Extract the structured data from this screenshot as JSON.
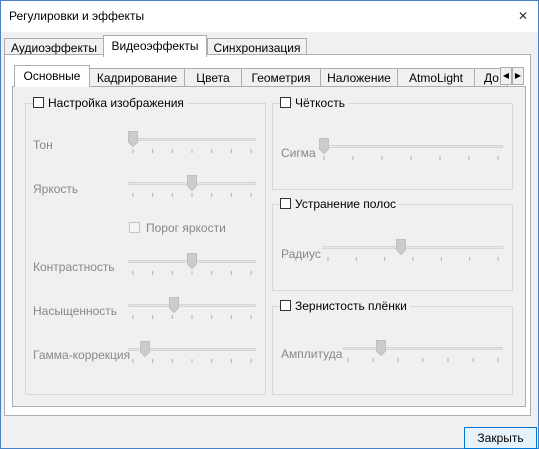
{
  "window": {
    "title": "Регулировки и эффекты"
  },
  "tabs": [
    "Аудиоэффекты",
    "Видеоэффекты",
    "Синхронизация"
  ],
  "subtabs": [
    "Основные",
    "Кадрирование",
    "Цвета",
    "Геометрия",
    "Наложение",
    "AtmoLight",
    "До"
  ],
  "image": {
    "title": "Настройка изображения",
    "tone": {
      "label": "Тон",
      "value": 0.0
    },
    "brightness": {
      "label": "Яркость",
      "value": 0.5
    },
    "threshold": {
      "label": "Порог яркости"
    },
    "contrast": {
      "label": "Контрастность",
      "value": 0.5
    },
    "saturation": {
      "label": "Насыщенность",
      "value": 0.35
    },
    "gamma": {
      "label": "Гамма-коррекция",
      "value": 0.1
    }
  },
  "sharpness": {
    "title": "Чёткость",
    "sigma": {
      "label": "Сигма",
      "value": 0.0
    }
  },
  "banding": {
    "title": "Устранение полос",
    "radius": {
      "label": "Радиус",
      "value": 0.43
    }
  },
  "grain": {
    "title": "Зернистость плёнки",
    "amplitude": {
      "label": "Амплитуда",
      "value": 0.22
    }
  },
  "close_button": "Закрыть"
}
